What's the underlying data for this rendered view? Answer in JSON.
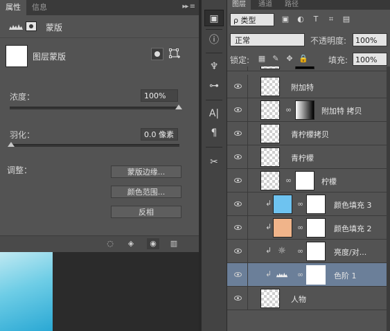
{
  "properties_panel": {
    "tabs": [
      {
        "label": "属性"
      },
      {
        "label": "信息"
      }
    ],
    "menu_glyph": "▸▸ ≡",
    "mode_title": "蒙版",
    "layer_mask_label": "图层蒙版",
    "density": {
      "label": "浓度：",
      "value": "100%",
      "level": 1.0
    },
    "feather": {
      "label": "羽化：",
      "value": "0.0 像素",
      "level": 0.0
    },
    "refine_label": "调整：",
    "buttons": {
      "mask_edge": "蒙版边缘...",
      "color_range": "颜色范围...",
      "invert": "反相"
    },
    "bottom_icons": [
      "load-selection-icon",
      "apply-mask-icon",
      "visibility-icon",
      "trash-icon"
    ]
  },
  "tool_strip": {
    "tools": [
      "3d-icon",
      "info-icon",
      "brush-presets-icon",
      "adjustments-icon",
      "character-icon",
      "paragraph-icon",
      "tools-icon"
    ]
  },
  "layers_panel": {
    "tabs": [
      {
        "label": "图层"
      },
      {
        "label": "通道"
      },
      {
        "label": "路径"
      }
    ],
    "kind_filter": "ρ 类型",
    "filter_icons": [
      "▣",
      "◐",
      "T",
      "⌗",
      "▤"
    ],
    "blend_mode": "正常",
    "opacity_label": "不透明度:",
    "opacity_value": "100%",
    "lock_label": "锁定:",
    "lock_icons": [
      "▦",
      "✎",
      "✥",
      "🔒"
    ],
    "fill_label": "填充:",
    "fill_value": "100%",
    "layers": [
      {
        "name": "附加特",
        "thumb": "checker"
      },
      {
        "name": "附加特 拷贝",
        "thumb": "checker",
        "mask": "grad"
      },
      {
        "name": "青柠檬拷贝",
        "thumb": "checker"
      },
      {
        "name": "青柠檬",
        "thumb": "checker"
      },
      {
        "name": "柠檬",
        "thumb": "checker",
        "mask": "white"
      },
      {
        "name": "颜色填充 3",
        "thumb": "blue",
        "mask": "white",
        "clipped": true
      },
      {
        "name": "颜色填充 2",
        "thumb": "peach",
        "mask": "white",
        "clipped": true
      },
      {
        "name": "亮度/对...",
        "adjustment": "brightness-icon",
        "mask": "white",
        "clipped": true
      },
      {
        "name": "色阶 1",
        "adjustment": "levels-icon",
        "mask": "white",
        "clipped": true,
        "selected": true
      },
      {
        "name": "人物",
        "thumb": "checker"
      }
    ]
  },
  "colors": {
    "panel": "#535353",
    "selected_row": "#6b7f99",
    "fill3": "#6ec3f0",
    "fill2": "#f0b48a"
  }
}
